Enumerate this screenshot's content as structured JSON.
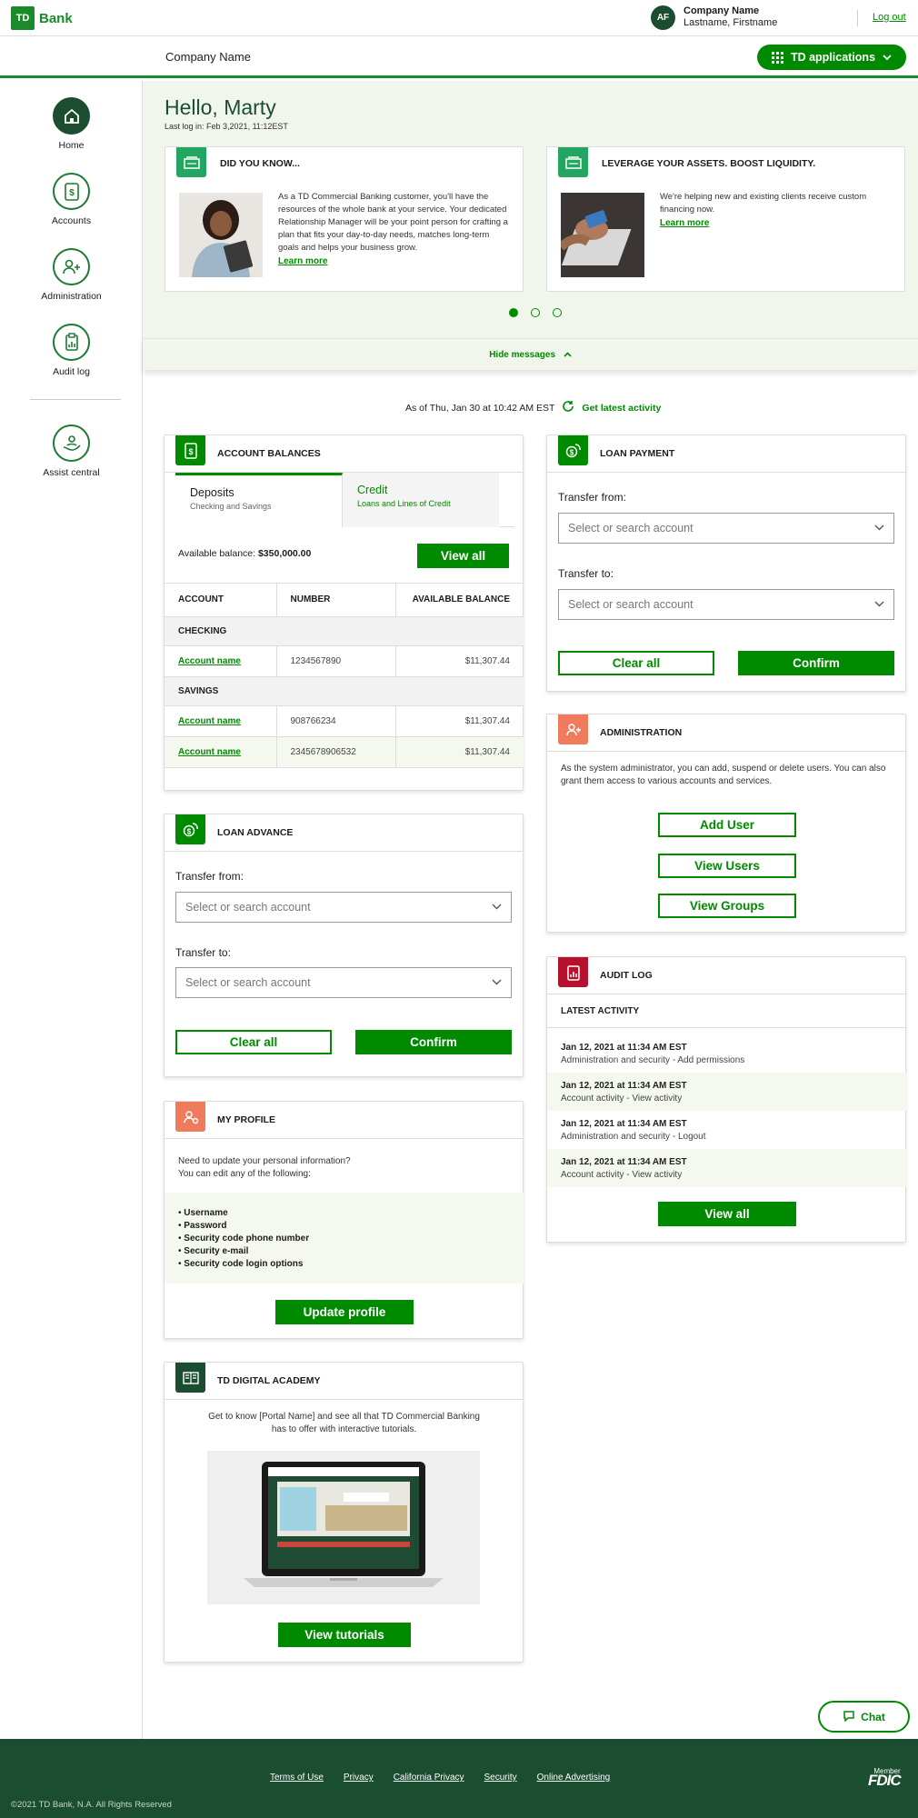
{
  "brand": {
    "logo_mark": "TD",
    "logo_word": "Bank",
    "color": "#008a00",
    "dark": "#1b4d31"
  },
  "user": {
    "initials": "AF",
    "company": "Company Name",
    "name": "Lastname, Firstname",
    "logout": "Log out"
  },
  "subbar": {
    "company": "Company Name",
    "apps_button": "TD applications"
  },
  "nav": {
    "items": [
      {
        "label": "Home",
        "icon": "home-icon"
      },
      {
        "label": "Accounts",
        "icon": "dollar-icon"
      },
      {
        "label": "Administration",
        "icon": "users-icon"
      },
      {
        "label": "Audit log",
        "icon": "clipboard-icon"
      },
      {
        "label": "Assist central",
        "icon": "hand-person-icon"
      }
    ]
  },
  "hero": {
    "greeting": "Hello, Marty",
    "last_login": "Last log in: Feb 3,2021, 11:12EST",
    "messages": [
      {
        "title": "DID YOU KNOW...",
        "text": "As a TD Commercial Banking customer, you'll have the resources of the whole bank at your service. Your dedicated Relationship Manager will be your point person for crafting a plan that fits your day-to-day needs, matches long-term goals and helps your business grow.",
        "link": "Learn more"
      },
      {
        "title": "LEVERAGE YOUR ASSETS. BOOST LIQUIDITY.",
        "text": "We're helping new and existing clients receive custom financing now.",
        "link": "Learn more"
      }
    ],
    "hide": "Hide messages"
  },
  "asof": {
    "text": "As of Thu, Jan 30 at 10:42 AM EST",
    "refresh": "Get latest activity"
  },
  "balances": {
    "title": "ACCOUNT BALANCES",
    "tab_deposits": "Deposits",
    "tab_deposits_sub": "Checking and Savings",
    "tab_credit": "Credit",
    "tab_credit_sub": "Loans and Lines of Credit",
    "avail_label": "Available balance:",
    "avail_value": "$350,000.00",
    "view_all": "View all",
    "columns": [
      "ACCOUNT",
      "NUMBER",
      "AVAILABLE BALANCE"
    ],
    "checking_label": "CHECKING",
    "savings_label": "SAVINGS",
    "rows": [
      {
        "name": "Account name",
        "number": "1234567890",
        "balance": "$11,307.44"
      },
      {
        "name": "Account name",
        "number": "908766234",
        "balance": "$11,307.44"
      },
      {
        "name": "Account name",
        "number": "2345678906532",
        "balance": "$11,307.44"
      }
    ]
  },
  "loan_payment": {
    "title": "LOAN PAYMENT",
    "from_label": "Transfer from:",
    "to_label": "Transfer to:",
    "placeholder": "Select or search account",
    "clear": "Clear all",
    "confirm": "Confirm"
  },
  "loan_advance": {
    "title": "LOAN ADVANCE",
    "from_label": "Transfer from:",
    "to_label": "Transfer to:",
    "placeholder": "Select or search account",
    "clear": "Clear all",
    "confirm": "Confirm"
  },
  "admin": {
    "title": "ADMINISTRATION",
    "text": "As the system administrator, you can add, suspend or delete users.  You can also grant them access to various accounts and services.",
    "add": "Add User",
    "view_users": "View Users",
    "view_groups": "View Groups"
  },
  "audit": {
    "title": "AUDIT LOG",
    "latest": "LATEST ACTIVITY",
    "rows": [
      {
        "time": "Jan 12, 2021 at 11:34 AM EST",
        "desc": "Administration and security - Add permissions"
      },
      {
        "time": "Jan 12, 2021 at 11:34 AM EST",
        "desc": "Account activity - View activity"
      },
      {
        "time": "Jan 12, 2021 at 11:34 AM EST",
        "desc": "Administration and security - Logout"
      },
      {
        "time": "Jan 12, 2021 at 11:34 AM EST",
        "desc": "Account activity - View activity"
      }
    ],
    "view_all": "View all"
  },
  "profile": {
    "title": "MY PROFILE",
    "line1": "Need to update your personal information?",
    "line2": "You can edit any of the following:",
    "items": [
      "Username",
      "Password",
      "Security code phone number",
      "Security e-mail",
      "Security code login options"
    ],
    "button": "Update profile"
  },
  "academy": {
    "title": "TD DIGITAL ACADEMY",
    "text": "Get to know [Portal Name] and see all that TD Commercial Banking has to offer with interactive tutorials.",
    "button": "View tutorials"
  },
  "chat": {
    "label": "Chat"
  },
  "footer": {
    "links": [
      "Terms of Use",
      "Privacy",
      "California Privacy",
      "Security",
      "Online Advertising"
    ],
    "copyright": "©2021 TD Bank, N.A. All Rights Reserved",
    "fdic_member": "Member",
    "fdic": "FDIC"
  }
}
